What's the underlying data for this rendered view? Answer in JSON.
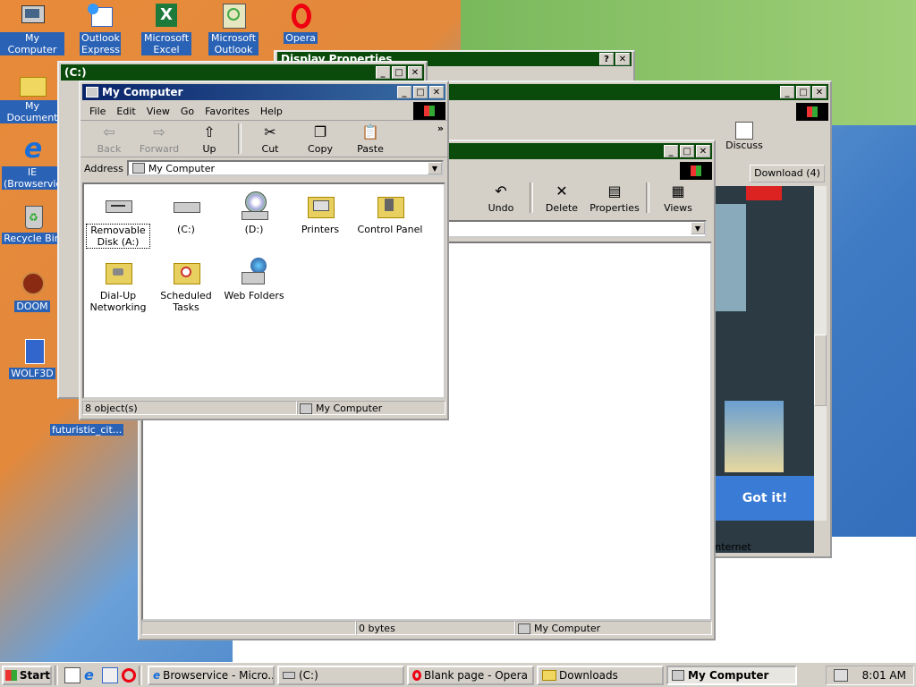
{
  "desktop": {
    "icons": [
      {
        "label": "My Computer"
      },
      {
        "label": "Outlook Express"
      },
      {
        "label": "Microsoft Excel"
      },
      {
        "label": "Microsoft Outlook"
      },
      {
        "label": "Opera"
      },
      {
        "label": "My Document"
      },
      {
        "label": "IE (Browservice)"
      },
      {
        "label": "Recycle Bin"
      },
      {
        "label": "DOOM"
      },
      {
        "label": "WOLF3D"
      },
      {
        "label": "futuristic_cit..."
      }
    ]
  },
  "display_properties": {
    "title": "Display Properties"
  },
  "c_window": {
    "title": "(C:)",
    "status_size": "0 bytes",
    "status_location": "My Computer",
    "toolbar": {
      "undo": "Undo",
      "delete": "Delete",
      "properties": "Properties",
      "views": "Views"
    }
  },
  "browser_window": {
    "discuss": "Discuss",
    "download": "Download (4)",
    "got_it": "Got it!",
    "status_zone": "Internet"
  },
  "mycomputer": {
    "title": "My Computer",
    "menu": [
      "File",
      "Edit",
      "View",
      "Go",
      "Favorites",
      "Help"
    ],
    "toolbar": {
      "back": "Back",
      "forward": "Forward",
      "up": "Up",
      "cut": "Cut",
      "copy": "Copy",
      "paste": "Paste"
    },
    "address_label": "Address",
    "address_value": "My Computer",
    "items": [
      {
        "label": "Removable Disk (A:)"
      },
      {
        "label": "(C:)"
      },
      {
        "label": "(D:)"
      },
      {
        "label": "Printers"
      },
      {
        "label": "Control Panel"
      },
      {
        "label": "Dial-Up Networking"
      },
      {
        "label": "Scheduled Tasks"
      },
      {
        "label": "Web Folders"
      }
    ],
    "status_count": "8 object(s)",
    "status_location": "My Computer"
  },
  "taskbar": {
    "start": "Start",
    "tasks": [
      "Browservice - Micro...",
      "(C:)",
      "Blank page - Opera",
      "Downloads",
      "My Computer"
    ],
    "clock": "8:01 AM"
  },
  "colors": {
    "title_active": "#0a246a",
    "title_inactive": "#0a4a0a",
    "desktop_blue": "#2e6ab8",
    "desktop_orange": "#e2893c"
  }
}
